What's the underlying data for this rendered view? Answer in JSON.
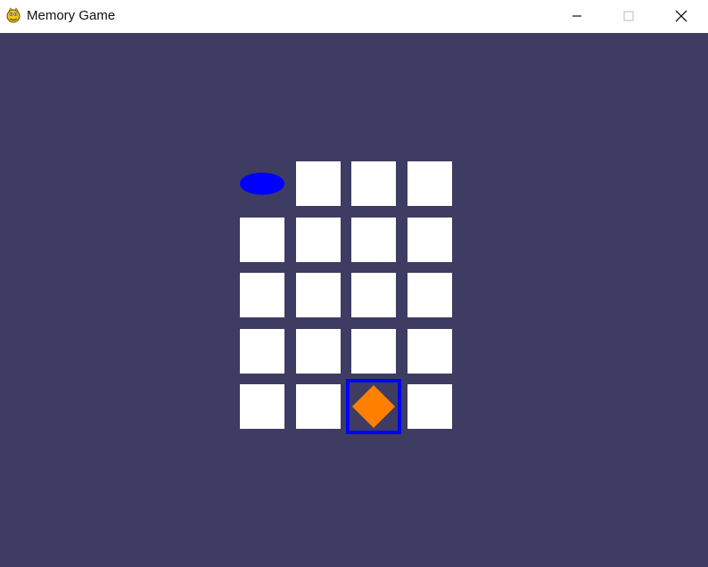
{
  "window": {
    "title": "Memory Game",
    "controls": {
      "minimize_icon": "minimize-icon",
      "maximize_icon": "maximize-icon",
      "close_icon": "close-icon"
    }
  },
  "game": {
    "background_color": "#3e3c63",
    "hidden_card_color": "#ffffff",
    "selection_color": "#0000ff",
    "grid": {
      "columns": 4,
      "rows": 5
    },
    "cards": [
      {
        "row": 0,
        "col": 0,
        "state": "revealed",
        "shape": "oval",
        "color": "#0000ff"
      },
      {
        "row": 0,
        "col": 1,
        "state": "hidden"
      },
      {
        "row": 0,
        "col": 2,
        "state": "hidden"
      },
      {
        "row": 0,
        "col": 3,
        "state": "hidden"
      },
      {
        "row": 1,
        "col": 0,
        "state": "hidden"
      },
      {
        "row": 1,
        "col": 1,
        "state": "hidden"
      },
      {
        "row": 1,
        "col": 2,
        "state": "hidden"
      },
      {
        "row": 1,
        "col": 3,
        "state": "hidden"
      },
      {
        "row": 2,
        "col": 0,
        "state": "hidden"
      },
      {
        "row": 2,
        "col": 1,
        "state": "hidden"
      },
      {
        "row": 2,
        "col": 2,
        "state": "hidden"
      },
      {
        "row": 2,
        "col": 3,
        "state": "hidden"
      },
      {
        "row": 3,
        "col": 0,
        "state": "hidden"
      },
      {
        "row": 3,
        "col": 1,
        "state": "hidden"
      },
      {
        "row": 3,
        "col": 2,
        "state": "hidden"
      },
      {
        "row": 3,
        "col": 3,
        "state": "hidden"
      },
      {
        "row": 4,
        "col": 0,
        "state": "hidden"
      },
      {
        "row": 4,
        "col": 1,
        "state": "hidden"
      },
      {
        "row": 4,
        "col": 2,
        "state": "revealed",
        "shape": "diamond",
        "color": "#ff8000",
        "selected": true
      },
      {
        "row": 4,
        "col": 3,
        "state": "hidden"
      }
    ]
  }
}
